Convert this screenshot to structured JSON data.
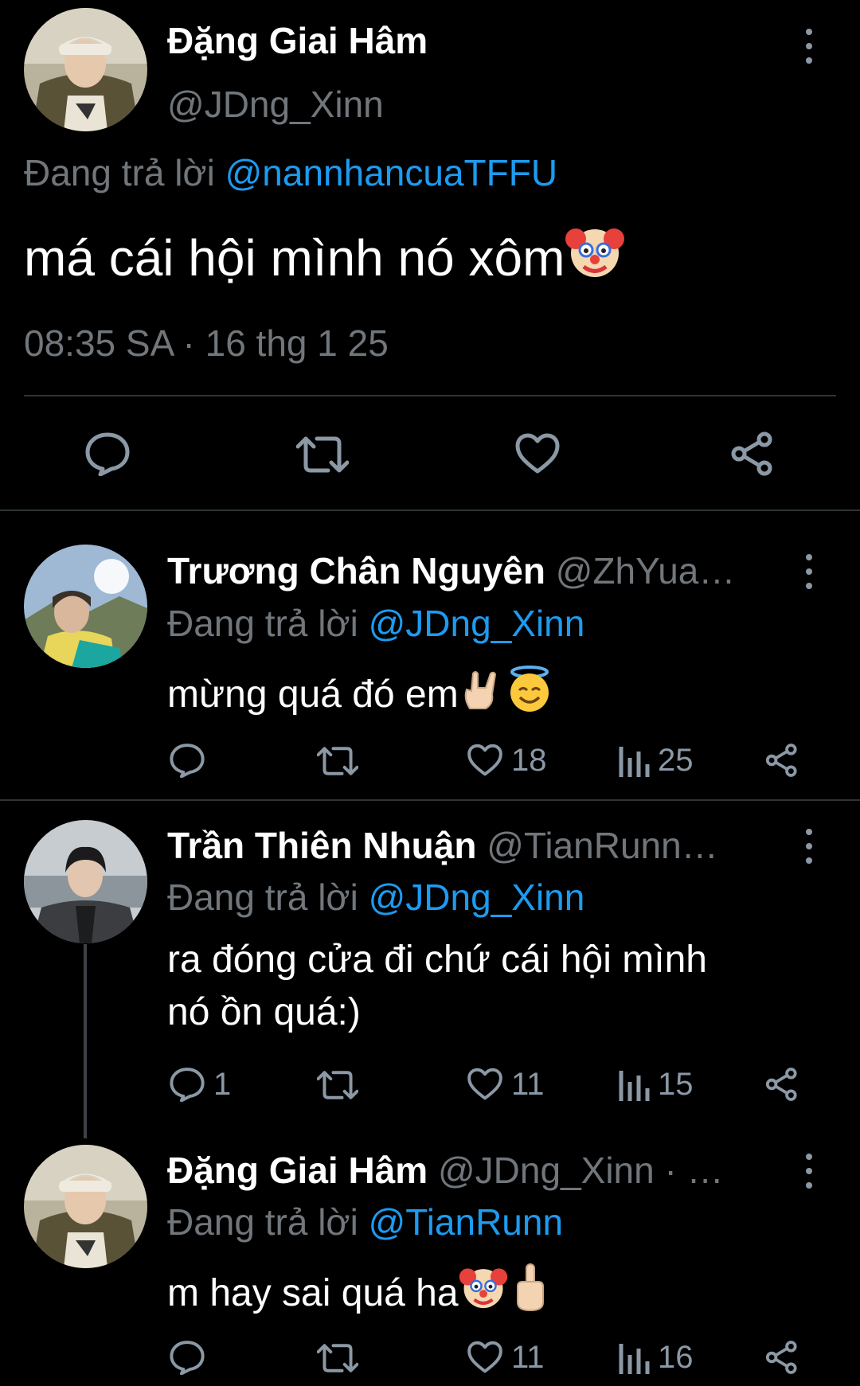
{
  "main_tweet": {
    "author_name": "Đặng Giai Hâm",
    "handle": "@JDng_Xinn",
    "reply_prefix": "Đang trả lời",
    "reply_to": "@nannhancuaTFFU",
    "text": "má cái hội mình nó xôm",
    "time": "08:35 SA",
    "separator": "·",
    "date": "16 thg 1 25",
    "actions": [
      "reply-icon",
      "retweet-icon",
      "like-icon",
      "share-icon"
    ]
  },
  "replies": [
    {
      "author_name": "Trương Chân Nguyên",
      "handle": "@ZhYua…",
      "reply_prefix": "Đang trả lời",
      "reply_to": "@JDng_Xinn",
      "text": "mừng quá đó em",
      "reply_count": "",
      "like_count": "18",
      "view_count": "25"
    },
    {
      "author_name": "Trần Thiên Nhuận",
      "handle": "@TianRunn…",
      "reply_prefix": "Đang trả lời",
      "reply_to": "@JDng_Xinn",
      "text_line1": "ra đóng cửa đi chứ cái hội mình",
      "text_line2": "nó ồn quá:)",
      "reply_count": "1",
      "like_count": "11",
      "view_count": "15"
    },
    {
      "author_name": "Đặng Giai Hâm",
      "handle": "@JDng_Xinn · …",
      "reply_prefix": "Đang trả lời",
      "reply_to": "@TianRunn",
      "text": "m hay sai quá ha",
      "reply_count": "",
      "like_count": "11",
      "view_count": "16"
    }
  ],
  "colors": {
    "background": "#000000",
    "text": "#e7e9ea",
    "muted": "#71767b",
    "link": "#1d9bf0",
    "divider": "#2f3336"
  }
}
